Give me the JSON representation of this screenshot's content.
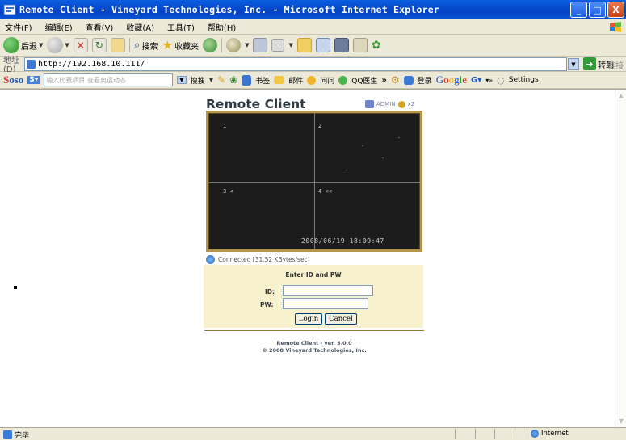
{
  "window": {
    "title": "Remote Client - Vineyard Technologies, Inc. - Microsoft Internet Explorer",
    "buttons": {
      "minimize": "_",
      "maximize": "□",
      "close": "X"
    }
  },
  "menu": {
    "items": [
      "文件(F)",
      "编辑(E)",
      "查看(V)",
      "收藏(A)",
      "工具(T)",
      "帮助(H)"
    ]
  },
  "toolbar": {
    "back_label": "后退",
    "search_label": "搜索",
    "favorites_label": "收藏夹"
  },
  "address": {
    "label": "地址(D)",
    "url": "http://192.168.10.111/",
    "go_label": "转到",
    "links_label": "链接"
  },
  "searchbar": {
    "brand_a": "S",
    "brand_b": "oso",
    "placeholder": "输入比赛项目 查看奥运动态",
    "search_label": "搜搜",
    "bookmarks_label": "书签",
    "mail_label": "邮件",
    "qq_label": "问问",
    "doctor_label": "QQ医生",
    "login_label": "登录",
    "google": [
      "G",
      "o",
      "o",
      "g",
      "l",
      "e"
    ],
    "settings_label": "Settings"
  },
  "page": {
    "title": "Remote Client",
    "user": "ADMIN",
    "user_suffix": "x2",
    "cams": [
      "1",
      "2",
      "3 <",
      "4 <<"
    ],
    "timestamp": "2008/06/19 18:09:47",
    "connection": "Connected [31.52 KBytes/sec]",
    "login": {
      "heading": "Enter ID and PW",
      "id_label": "ID:",
      "pw_label": "PW:",
      "id_value": "",
      "pw_value": "",
      "login_button": "Login",
      "cancel_button": "Cancel"
    },
    "footer_version": "Remote Client - ver. 3.0.0",
    "footer_copyright": "© 2008 Vineyard Technologies, Inc."
  },
  "status": {
    "left": "完毕",
    "zone": "Internet"
  },
  "colors": {
    "titlebar": "#0442c4",
    "video_border": "#b3954c",
    "login_panel": "#f7f1cd"
  }
}
